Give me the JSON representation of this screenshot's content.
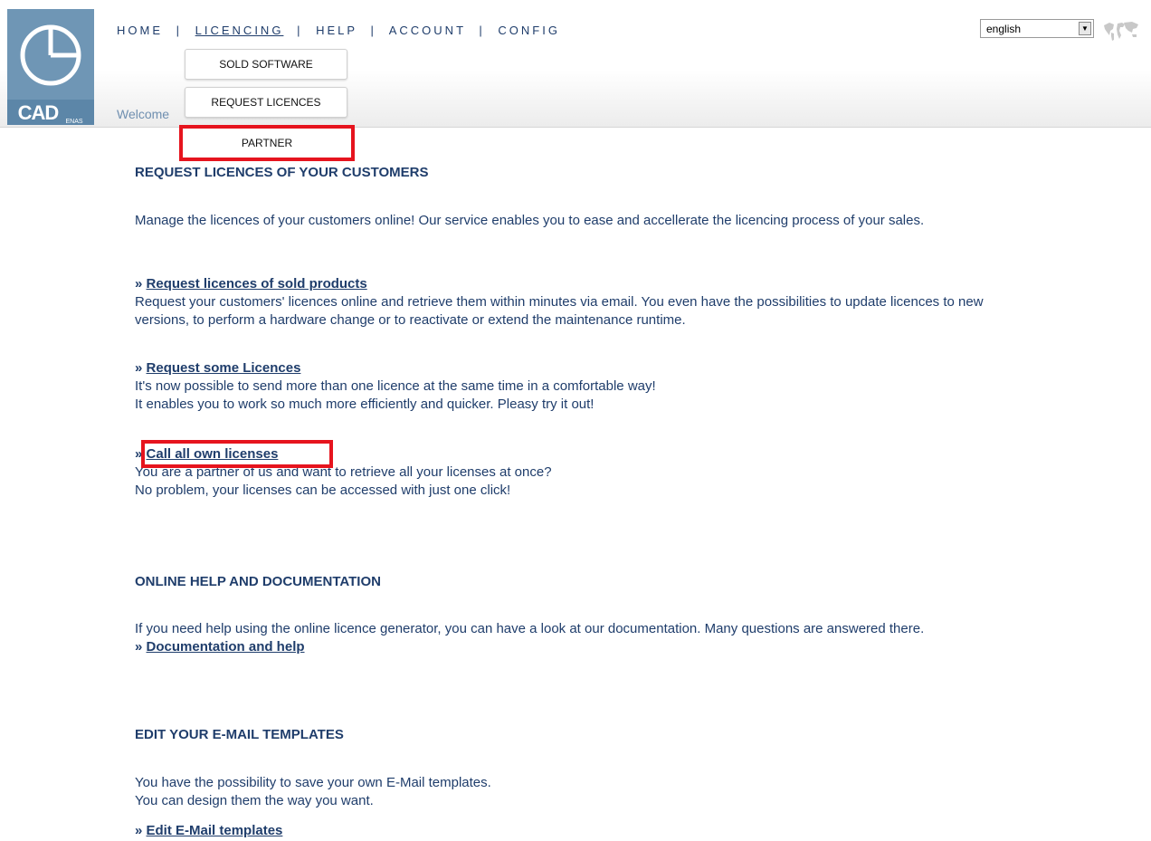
{
  "header": {
    "logo_text": "CAD",
    "logo_subtext": "ENAS",
    "welcome_text": "Welcome"
  },
  "nav": {
    "items": [
      {
        "label": "HOME"
      },
      {
        "label": "LICENCING"
      },
      {
        "label": "HELP"
      },
      {
        "label": "ACCOUNT"
      },
      {
        "label": "CONFIG"
      }
    ],
    "separator": "|"
  },
  "dropdown": {
    "items": [
      {
        "label": "SOLD SOFTWARE"
      },
      {
        "label": "REQUEST LICENCES"
      },
      {
        "label": "PARTNER"
      }
    ]
  },
  "language": {
    "selected": "english",
    "arrow": "▼"
  },
  "sections": {
    "request": {
      "title": "REQUEST LICENCES OF YOUR CUSTOMERS",
      "intro": "Manage the licences of your customers online! Our service enables you to ease and accellerate the licencing process of your sales.",
      "links": [
        {
          "label": "Request licences of sold products",
          "desc": "Request your customers' licences online and retrieve them within minutes via email. You even have the possibilities to update licences to new versions, to perform a hardware change or to reactivate or extend the maintenance runtime."
        },
        {
          "label": "Request some Licences",
          "desc1": "It's now possible to send more than one licence at the same time in a comfortable way!",
          "desc2": "It enables you to work so much more efficiently and quicker. Pleasy try it out!"
        },
        {
          "label": "Call all own licenses",
          "desc1": "You are a partner of us and want to retrieve all your licenses at once?",
          "desc2": "No problem, your licenses can be accessed with just one click!"
        }
      ]
    },
    "help": {
      "title": "ONLINE HELP AND DOCUMENTATION",
      "intro": "If you need help using the online licence generator, you can have a look at our documentation. Many questions are answered there.",
      "link": "Documentation and help"
    },
    "email": {
      "title": "EDIT YOUR E-MAIL TEMPLATES",
      "line1": "You have the possibility to save your own E-Mail templates.",
      "line2": "You can design them the way you want.",
      "link": "Edit E-Mail templates"
    }
  },
  "raquo": "»",
  "colors": {
    "text": "#1f3d6b",
    "logo_bg": "#6f96b5",
    "highlight": "#e6141e"
  }
}
